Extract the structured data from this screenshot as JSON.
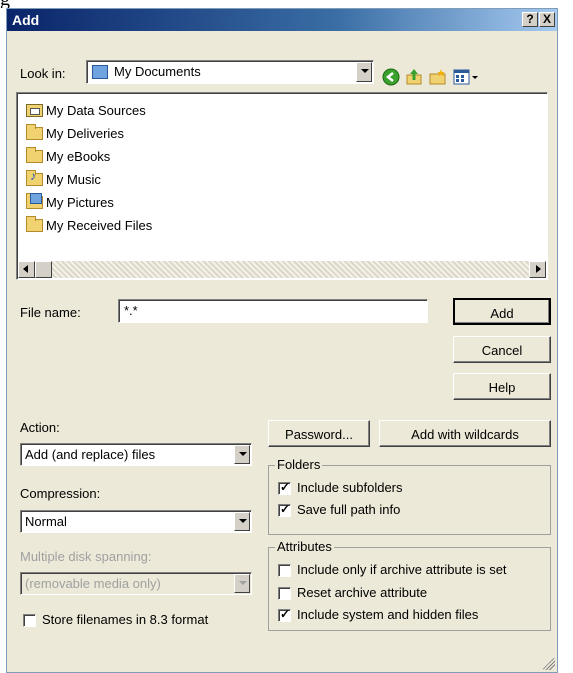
{
  "window": {
    "title": "Add",
    "help_btn": "?",
    "close_btn": "X"
  },
  "look_in": {
    "label": "Look in:",
    "value": "My Documents"
  },
  "toolbar_icons": [
    "back-icon",
    "up-folder-icon",
    "new-folder-icon",
    "views-menu-icon"
  ],
  "files": [
    {
      "name": "My Data Sources",
      "icon": "data-sources-folder-icon"
    },
    {
      "name": "My Deliveries",
      "icon": "folder-icon"
    },
    {
      "name": "My eBooks",
      "icon": "folder-icon"
    },
    {
      "name": "My Music",
      "icon": "music-folder-icon"
    },
    {
      "name": "My Pictures",
      "icon": "pictures-folder-icon"
    },
    {
      "name": "My Received Files",
      "icon": "folder-icon"
    }
  ],
  "filename": {
    "label": "File name:",
    "value": "*.*"
  },
  "buttons": {
    "add": "Add",
    "cancel": "Cancel",
    "help": "Help",
    "password": "Password...",
    "add_wildcards": "Add with wildcards"
  },
  "action": {
    "label": "Action:",
    "value": "Add (and replace) files"
  },
  "compression": {
    "label": "Compression:",
    "value": "Normal"
  },
  "spanning": {
    "label": "Multiple disk spanning:",
    "value": "(removable media only)"
  },
  "store83": {
    "label": "Store filenames in 8.3 format",
    "checked": false
  },
  "folders": {
    "title": "Folders",
    "include_subfolders": {
      "label": "Include subfolders",
      "checked": true
    },
    "save_full_path": {
      "label": "Save full path info",
      "checked": true
    }
  },
  "attributes": {
    "title": "Attributes",
    "archive_only": {
      "label": "Include only if archive attribute is set",
      "checked": false
    },
    "reset_archive": {
      "label": "Reset archive attribute",
      "checked": false
    },
    "system_hidden": {
      "label": "Include system and hidden files",
      "checked": true
    }
  },
  "colors": {
    "title_bar_start": "#0a246a",
    "title_bar_end": "#a6caf0",
    "dialog_bg": "#ece9d8"
  }
}
